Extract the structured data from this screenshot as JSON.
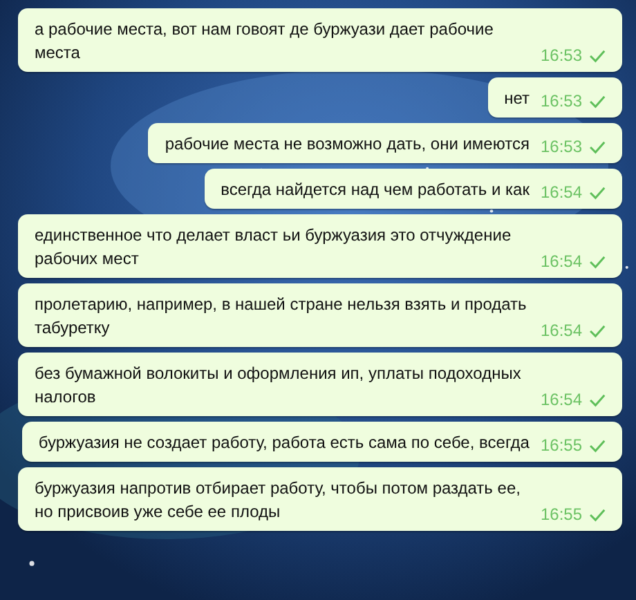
{
  "messages": [
    {
      "text": "а рабочие места, вот нам говоят де буржуази дает рабочие места",
      "time": "16:53",
      "read": false
    },
    {
      "text": "нет",
      "time": "16:53",
      "read": false
    },
    {
      "text": "рабочие места не возможно дать, они имеются",
      "time": "16:53",
      "read": false
    },
    {
      "text": "всегда найдется над чем работать и как",
      "time": "16:54",
      "read": false
    },
    {
      "text": "единственное что делает власт ьи буржуазия это отчуждение рабочих мест",
      "time": "16:54",
      "read": false
    },
    {
      "text": "пролетарию, например, в нашей стране нельзя взять и продать табуретку",
      "time": "16:54",
      "read": false
    },
    {
      "text": "без бумажной волокиты и оформления ип, уплаты подоходных налогов",
      "time": "16:54",
      "read": false
    },
    {
      "text": "буржуазия не создает работу, работа есть сама по себе, всегда",
      "time": "16:55",
      "read": false
    },
    {
      "text": "буржуазия напротив отбирает работу, чтобы потом раздать ее, но присвоив уже себе ее плоды",
      "time": "16:55",
      "read": false
    }
  ]
}
